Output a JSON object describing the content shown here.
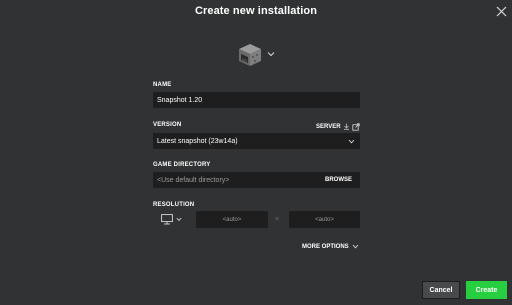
{
  "dialog": {
    "title": "Create new installation"
  },
  "name_section": {
    "label": "NAME",
    "value": "Snapshot 1.20"
  },
  "version_section": {
    "label": "VERSION",
    "server_link": "SERVER",
    "selected": "Latest snapshot (23w14a)"
  },
  "directory_section": {
    "label": "GAME DIRECTORY",
    "placeholder": "<Use default directory>",
    "browse_label": "BROWSE"
  },
  "resolution_section": {
    "label": "RESOLUTION",
    "width_placeholder": "<auto>",
    "height_placeholder": "<auto>",
    "separator": "×"
  },
  "more_options_label": "MORE OPTIONS",
  "buttons": {
    "cancel": "Cancel",
    "create": "Create"
  },
  "colors": {
    "background": "#313233",
    "field": "#1e1e1f",
    "create_button": "#27ce40",
    "cancel_button": "#48494a"
  },
  "icons": {
    "close": "close-icon",
    "installation": "furnace-block-icon",
    "chevron": "chevron-down-icon",
    "download": "download-icon",
    "external_link": "external-link-icon",
    "monitor": "monitor-icon"
  }
}
